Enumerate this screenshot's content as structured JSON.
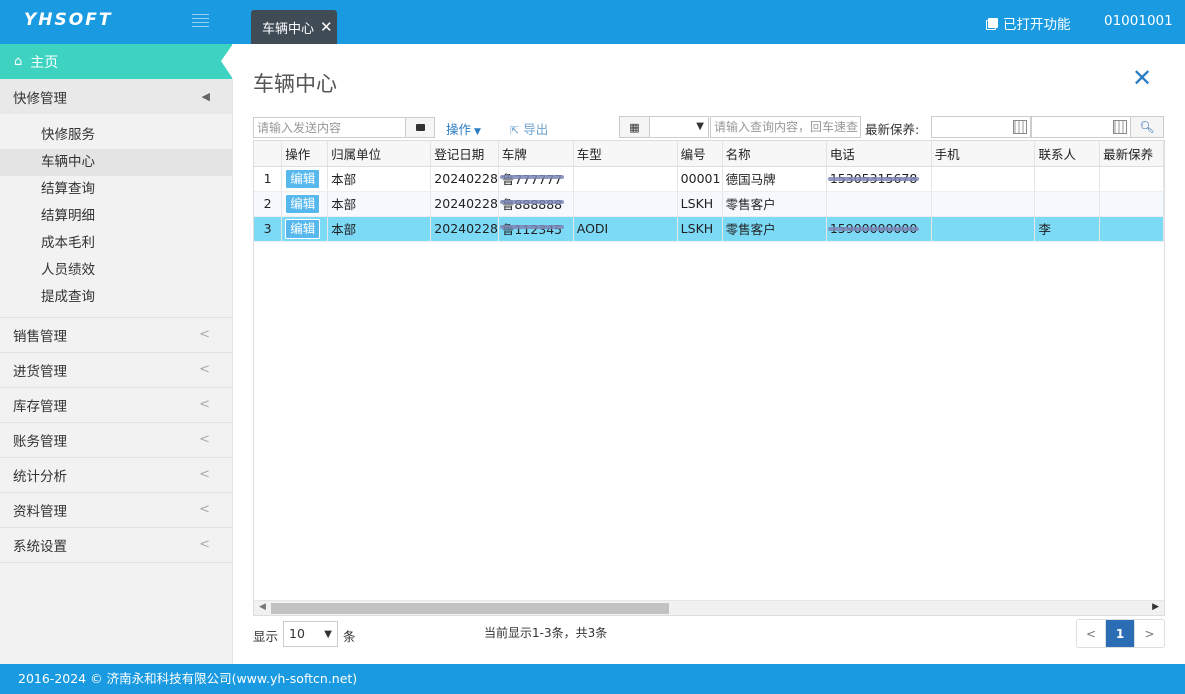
{
  "header": {
    "logo": "YHSOFT",
    "tab_label": "车辆中心",
    "opened_functions": "已打开功能",
    "user_id": "01001001"
  },
  "sidebar": {
    "home": "主页",
    "groups": [
      {
        "label": "快修管理",
        "open": true,
        "items": [
          "快修服务",
          "车辆中心",
          "结算查询",
          "结算明细",
          "成本毛利",
          "人员绩效",
          "提成查询"
        ],
        "active": "车辆中心"
      },
      {
        "label": "销售管理"
      },
      {
        "label": "进货管理"
      },
      {
        "label": "库存管理"
      },
      {
        "label": "账务管理"
      },
      {
        "label": "统计分析"
      },
      {
        "label": "资料管理"
      },
      {
        "label": "系统设置"
      }
    ]
  },
  "page": {
    "title": "车辆中心"
  },
  "toolbar": {
    "send_placeholder": "请输入发送内容",
    "operate": "操作",
    "export": "导出",
    "query_placeholder": "请输入查询内容，回车速查",
    "maintenance_label": "最新保养:"
  },
  "table": {
    "columns": [
      "",
      "操作",
      "归属单位",
      "登记日期",
      "车牌",
      "车型",
      "编号",
      "名称",
      "电话",
      "手机",
      "联系人",
      "最新保养"
    ],
    "edit_label": "编辑",
    "rows": [
      {
        "no": "1",
        "unit": "本部",
        "date": "20240228",
        "plate": "鲁777777",
        "model": "",
        "code": "00001",
        "name": "德国马牌",
        "phone": "15305315678",
        "mobile": "",
        "contact": "",
        "maint": ""
      },
      {
        "no": "2",
        "unit": "本部",
        "date": "20240228",
        "plate": "鲁888888",
        "model": "",
        "code": "LSKH",
        "name": "零售客户",
        "phone": "",
        "mobile": "",
        "contact": "",
        "maint": ""
      },
      {
        "no": "3",
        "unit": "本部",
        "date": "20240228",
        "plate": "鲁112345",
        "model": "AODI",
        "code": "LSKH",
        "name": "零售客户",
        "phone": "15900000000",
        "mobile": "",
        "contact": "李",
        "maint": ""
      }
    ]
  },
  "pagination": {
    "show_label": "显示",
    "page_size": "10",
    "unit_label": "条",
    "info": "当前显示1-3条，共3条",
    "prev": "<",
    "current": "1",
    "next": ">"
  },
  "footer": {
    "text": "2016-2024 © 济南永和科技有限公司(www.yh-softcn.net)"
  },
  "colors": {
    "primary": "#1a9ae0",
    "home_active": "#3ed3c0",
    "selected_row": "#7cdaf7",
    "edit_button": "#57b8ed",
    "pager_active": "#2a6db5"
  }
}
